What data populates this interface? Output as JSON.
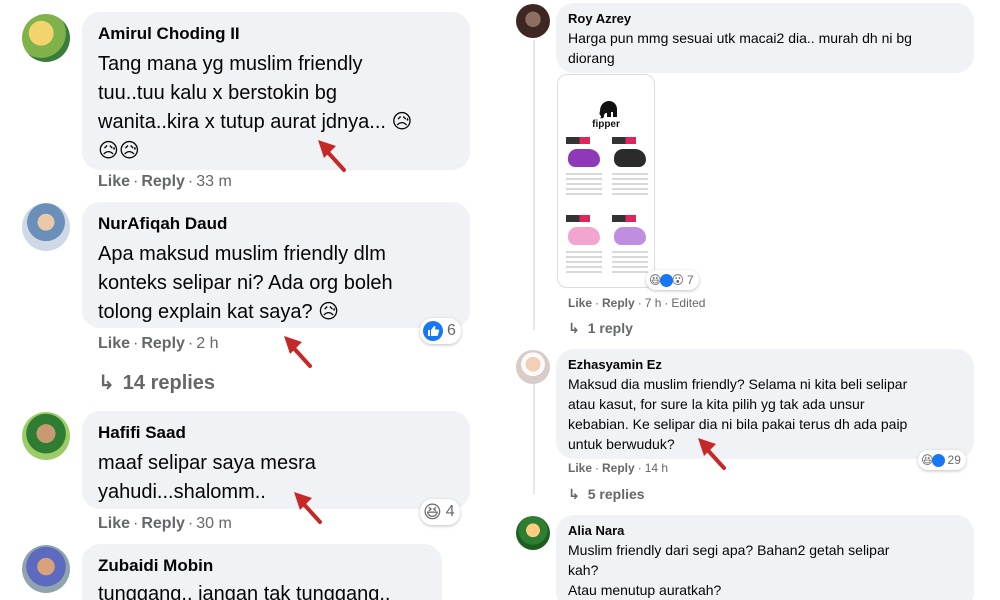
{
  "left_comments": [
    {
      "author": "Amirul Choding II",
      "lines": [
        "Tang mana yg muslim friendly",
        "tuu..tuu kalu x berstokin bg",
        "wanita..kira x tutup aurat jdnya... 😥",
        "😥😥"
      ],
      "actions": {
        "like": "Like",
        "reply": "Reply",
        "time": "33 m"
      }
    },
    {
      "author": "NurAfiqah Daud",
      "lines": [
        "Apa maksud muslim friendly dlm",
        "konteks selipar ni? Ada org boleh",
        "tolong explain kat saya? 😥"
      ],
      "actions": {
        "like": "Like",
        "reply": "Reply",
        "time": "2 h"
      },
      "reaction_count": "6",
      "replies_label": "14 replies"
    },
    {
      "author": "Hafifi Saad",
      "lines": [
        "maaf selipar saya mesra",
        "yahudi...shalomm.."
      ],
      "actions": {
        "like": "Like",
        "reply": "Reply",
        "time": "30 m"
      },
      "reaction_count": "4"
    },
    {
      "author": "Zubaidi Mobin",
      "lines": [
        "tunggang.. jangan tak tunggang.."
      ]
    }
  ],
  "right_comments": [
    {
      "author": "Roy Azrey",
      "lines": [
        "Harga pun mmg sesuai utk macai2 dia.. murah dh ni bg",
        "diorang"
      ],
      "attachment_brand": "fipper",
      "reaction_count": "7",
      "actions": {
        "like": "Like",
        "reply": "Reply",
        "time": "7 h",
        "edited": "Edited"
      },
      "replies_label": "1 reply"
    },
    {
      "author": "Ezhasyamin Ez",
      "lines": [
        "Maksud dia muslim friendly? Selama ni kita beli selipar",
        "atau kasut, for sure la kita pilih yg tak ada unsur",
        "kebabian. Ke selipar dia ni bila pakai terus dh ada paip",
        "untuk berwuduk?"
      ],
      "actions": {
        "like": "Like",
        "reply": "Reply",
        "time": "14 h"
      },
      "reaction_count": "29",
      "replies_label": "5 replies"
    },
    {
      "author": "Alia Nara",
      "lines": [
        "Muslim friendly dari segi apa? Bahan2 getah selipar",
        "kah?",
        "Atau menutup auratkah?"
      ]
    }
  ],
  "colors": {
    "bubble": "#f0f2f5",
    "meta": "#65676b",
    "like_blue": "#1877f2",
    "annotation_red": "#c62828"
  }
}
